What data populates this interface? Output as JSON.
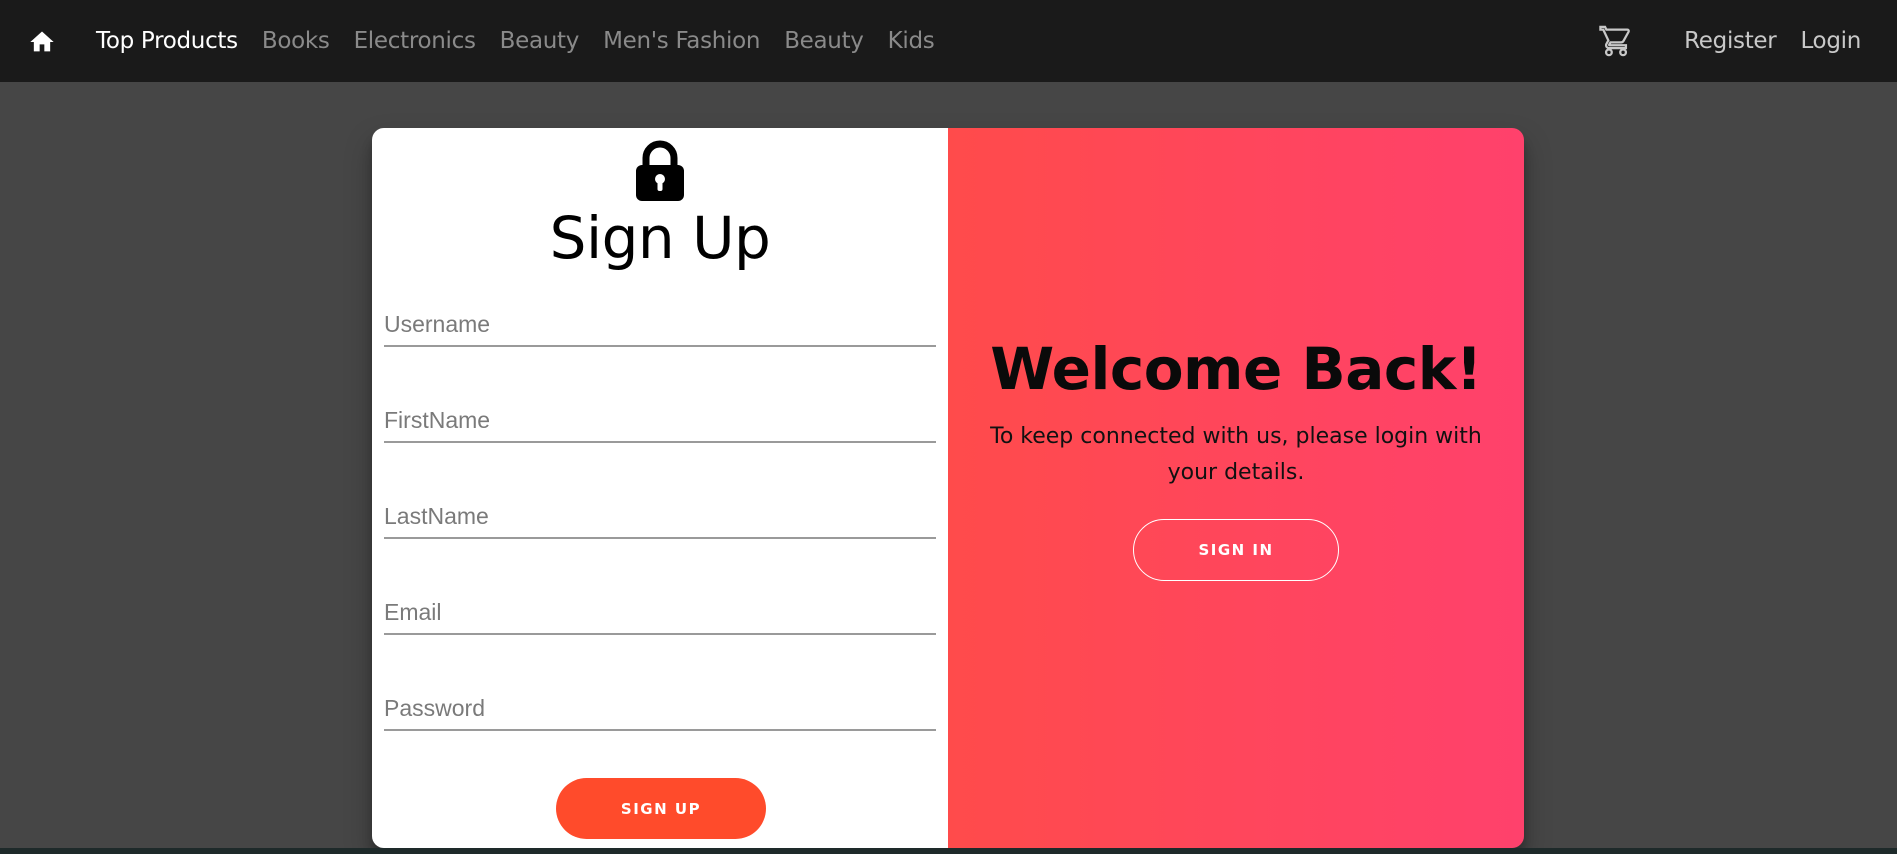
{
  "navbar": {
    "home_icon": "home-icon",
    "links": [
      {
        "label": "Top Products"
      },
      {
        "label": "Books"
      },
      {
        "label": "Electronics"
      },
      {
        "label": "Beauty"
      },
      {
        "label": "Men's Fashion"
      },
      {
        "label": "Beauty"
      },
      {
        "label": "Kids"
      }
    ],
    "cart_icon": "shopping-cart-icon",
    "register_label": "Register",
    "login_label": "Login"
  },
  "signup": {
    "lock_icon": "lock-icon",
    "title": "Sign Up",
    "fields": {
      "username": {
        "placeholder": "Username",
        "value": ""
      },
      "firstname": {
        "placeholder": "FirstName",
        "value": ""
      },
      "lastname": {
        "placeholder": "LastName",
        "value": ""
      },
      "email": {
        "placeholder": "Email",
        "value": ""
      },
      "password": {
        "placeholder": "Password",
        "value": ""
      }
    },
    "button_label": "SIGN UP"
  },
  "welcome": {
    "title": "Welcome Back!",
    "text": "To keep connected with us, please login with your details.",
    "button_label": "SIGN IN"
  },
  "colors": {
    "navbar_bg": "#1a1a1a",
    "page_bg": "#464646",
    "accent_orange": "#ff4b2b",
    "gradient_start": "#ff4b4b",
    "gradient_end": "#ff416c"
  }
}
